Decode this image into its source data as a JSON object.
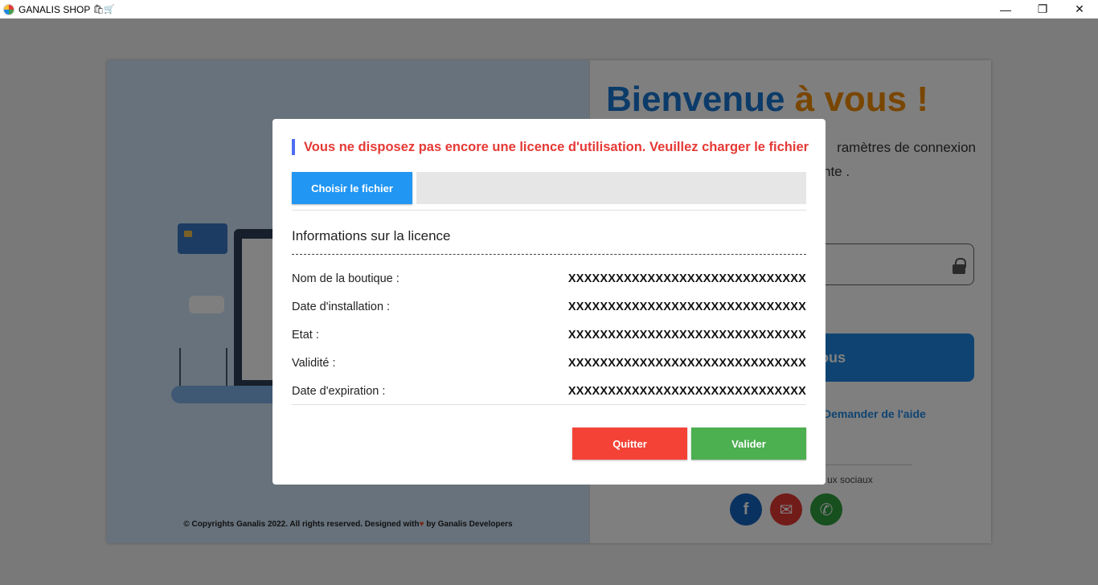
{
  "window": {
    "title": "GANALIS SHOP",
    "title_emoji": "🛍🛒",
    "minimize_glyph": "—",
    "maximize_glyph": "❐",
    "close_glyph": "✕"
  },
  "login": {
    "welcome_main": "Bienvenue",
    "welcome_accent": "à vous !",
    "subtext_line1": "ramètres de connexion",
    "subtext_line2": "nte .",
    "login_button_partial": "ous",
    "help_link": "Demander de l'aide",
    "social_label": "ux sociaux",
    "copyright_prefix": "© Copyrights Ganalis 2022. All rights reserved. Designed with",
    "copyright_suffix": "by Ganalis Developers",
    "heart_glyph": "♥"
  },
  "social": {
    "facebook_glyph": "f",
    "mail_glyph": "✉",
    "whatsapp_glyph": "✆"
  },
  "modal": {
    "title": "Vous ne disposez pas encore une licence d'utilisation. Veuillez charger le fichier",
    "choose_file_label": "Choisir le fichier",
    "file_value": "",
    "section_title": "Informations sur la licence",
    "rows": [
      {
        "label": "Nom de la boutique :",
        "value": "XXXXXXXXXXXXXXXXXXXXXXXXXXXXXX"
      },
      {
        "label": "Date d'installation :",
        "value": "XXXXXXXXXXXXXXXXXXXXXXXXXXXXXX"
      },
      {
        "label": "Etat :",
        "value": "XXXXXXXXXXXXXXXXXXXXXXXXXXXXXX"
      },
      {
        "label": "Validité :",
        "value": "XXXXXXXXXXXXXXXXXXXXXXXXXXXXXX"
      },
      {
        "label": "Date d'expiration :",
        "value": "XXXXXXXXXXXXXXXXXXXXXXXXXXXXXX"
      }
    ],
    "quit_label": "Quitter",
    "validate_label": "Valider"
  },
  "colors": {
    "title_red": "#e53935",
    "choose_blue": "#2196f3",
    "quit_red": "#f44336",
    "validate_green": "#4caf50",
    "title_accent_bar": "#4e6ef2"
  }
}
